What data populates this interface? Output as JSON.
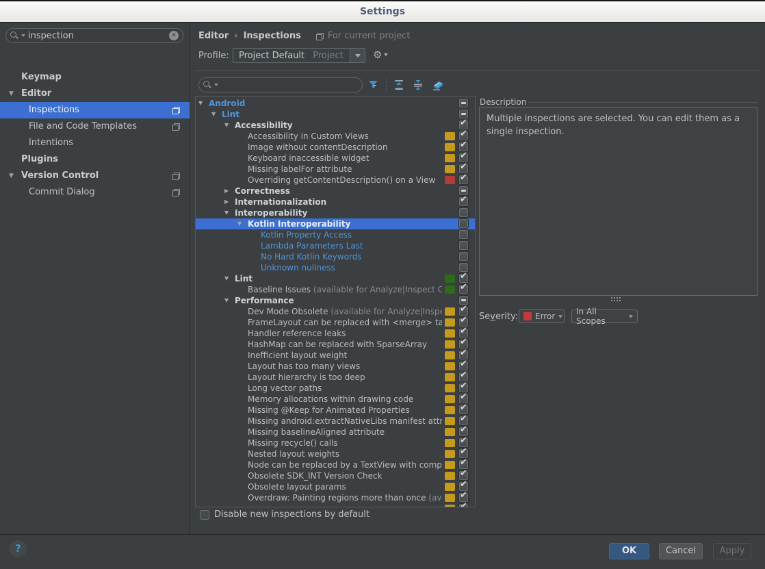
{
  "window": {
    "title": "Settings"
  },
  "colors": {
    "background": "#3c3f41",
    "selection_blue": "#3c6fd1",
    "changed_text_blue": "#5193d9",
    "severity_amber": "#c59a1d",
    "severity_red": "#b73a3a",
    "severity_green": "#2d6b1b",
    "toolbar_icon_blue": "#3d8fc6"
  },
  "sidebar": {
    "search": {
      "value": "inspection",
      "clear_icon": "close-circle-icon"
    },
    "items": [
      {
        "label": "Keymap",
        "level": 0,
        "bold": true
      },
      {
        "label": "Editor",
        "level": 0,
        "bold": true,
        "expanded": true
      },
      {
        "label": "Inspections",
        "level": 1,
        "selected": true,
        "copyIcon": true
      },
      {
        "label": "File and Code Templates",
        "level": 1,
        "copyIcon": true
      },
      {
        "label": "Intentions",
        "level": 1
      },
      {
        "label": "Plugins",
        "level": 0,
        "bold": true
      },
      {
        "label": "Version Control",
        "level": 0,
        "bold": true,
        "expanded": true,
        "copyIcon": true
      },
      {
        "label": "Commit Dialog",
        "level": 1,
        "copyIcon": true
      }
    ]
  },
  "header": {
    "breadcrumb": {
      "0": "Editor",
      "1": "Inspections",
      "separator": "›"
    },
    "scope_note": "For current project",
    "profile_label": "Profile:",
    "profile_value": "Project Default",
    "profile_suffix": "Project"
  },
  "toolbar": {
    "search_value": "",
    "icons": [
      "filter-icon",
      "expand-all-icon",
      "collapse-all-icon",
      "reset-filter-icon"
    ]
  },
  "inspection_tree": {
    "rows": [
      {
        "label": "Android",
        "level": 0,
        "arrow": "down",
        "style": "group-changed",
        "check": "dash"
      },
      {
        "label": "Lint",
        "level": 1,
        "arrow": "down",
        "style": "group-changed",
        "check": "dash"
      },
      {
        "label": "Accessibility",
        "level": 2,
        "arrow": "down",
        "style": "group",
        "check": "checked"
      },
      {
        "label": "Accessibility in Custom Views",
        "level": 3,
        "style": "item",
        "swatch": "amber",
        "check": "checked"
      },
      {
        "label": "Image without contentDescription",
        "level": 3,
        "style": "item",
        "swatch": "amber",
        "check": "checked"
      },
      {
        "label": "Keyboard inaccessible widget",
        "level": 3,
        "style": "item",
        "swatch": "amber",
        "check": "checked"
      },
      {
        "label": "Missing labelFor attribute",
        "level": 3,
        "style": "item",
        "swatch": "amber",
        "check": "checked"
      },
      {
        "label": "Overriding getContentDescription() on a View",
        "level": 3,
        "style": "item",
        "swatch": "red",
        "check": "checked"
      },
      {
        "label": "Correctness",
        "level": 2,
        "arrow": "right",
        "style": "group",
        "check": "dash"
      },
      {
        "label": "Internationalization",
        "level": 2,
        "arrow": "right",
        "style": "group",
        "check": "checked"
      },
      {
        "label": "Interoperability",
        "level": 2,
        "arrow": "down",
        "style": "group",
        "check": "unchecked"
      },
      {
        "label": "Kotlin Interoperability",
        "level": 3,
        "arrow": "down",
        "style": "group",
        "check": "unchecked",
        "selected": true
      },
      {
        "label": "Kotlin Property Access",
        "level": 4,
        "style": "item-changed",
        "check": "unchecked"
      },
      {
        "label": "Lambda Parameters Last",
        "level": 4,
        "style": "item-changed",
        "check": "unchecked"
      },
      {
        "label": "No Hard Kotlin Keywords",
        "level": 4,
        "style": "item-changed",
        "check": "unchecked"
      },
      {
        "label": "Unknown nullness",
        "level": 4,
        "style": "item-changed",
        "check": "unchecked"
      },
      {
        "label": "Lint",
        "level": 2,
        "arrow": "down",
        "style": "group",
        "swatch": "green",
        "check": "checked"
      },
      {
        "label": "Baseline Issues",
        "note": "(available for Analyze|Inspect Co",
        "level": 3,
        "style": "item",
        "swatch": "green",
        "check": "checked"
      },
      {
        "label": "Performance",
        "level": 2,
        "arrow": "down",
        "style": "group",
        "check": "dash"
      },
      {
        "label": "Dev Mode Obsolete",
        "note": "(available for Analyze|Inspec",
        "level": 3,
        "style": "item",
        "swatch": "amber",
        "check": "checked"
      },
      {
        "label": "FrameLayout can be replaced with <merge> ta",
        "level": 3,
        "style": "item",
        "swatch": "amber",
        "check": "checked"
      },
      {
        "label": "Handler reference leaks",
        "level": 3,
        "style": "item",
        "swatch": "amber",
        "check": "checked"
      },
      {
        "label": "HashMap can be replaced with SparseArray",
        "level": 3,
        "style": "item",
        "swatch": "amber",
        "check": "checked"
      },
      {
        "label": "Inefficient layout weight",
        "level": 3,
        "style": "item",
        "swatch": "amber",
        "check": "checked"
      },
      {
        "label": "Layout has too many views",
        "level": 3,
        "style": "item",
        "swatch": "amber",
        "check": "checked"
      },
      {
        "label": "Layout hierarchy is too deep",
        "level": 3,
        "style": "item",
        "swatch": "amber",
        "check": "checked"
      },
      {
        "label": "Long vector paths",
        "level": 3,
        "style": "item",
        "swatch": "amber",
        "check": "checked"
      },
      {
        "label": "Memory allocations within drawing code",
        "level": 3,
        "style": "item",
        "swatch": "amber",
        "check": "checked"
      },
      {
        "label": "Missing @Keep for Animated Properties",
        "level": 3,
        "style": "item",
        "swatch": "amber",
        "check": "checked"
      },
      {
        "label": "Missing android:extractNativeLibs manifest attr",
        "level": 3,
        "style": "item",
        "swatch": "amber",
        "check": "checked"
      },
      {
        "label": "Missing baselineAligned attribute",
        "level": 3,
        "style": "item",
        "swatch": "amber",
        "check": "checked"
      },
      {
        "label": "Missing recycle() calls",
        "level": 3,
        "style": "item",
        "swatch": "amber",
        "check": "checked"
      },
      {
        "label": "Nested layout weights",
        "level": 3,
        "style": "item",
        "swatch": "amber",
        "check": "checked"
      },
      {
        "label": "Node can be replaced by a TextView with comp",
        "level": 3,
        "style": "item",
        "swatch": "amber",
        "check": "checked"
      },
      {
        "label": "Obsolete SDK_INT Version Check",
        "level": 3,
        "style": "item",
        "swatch": "amber",
        "check": "checked"
      },
      {
        "label": "Obsolete layout params",
        "level": 3,
        "style": "item",
        "swatch": "amber",
        "check": "checked"
      },
      {
        "label": "Overdraw: Painting regions more than once",
        "note": "(av",
        "level": 3,
        "style": "item",
        "swatch": "amber",
        "check": "checked"
      },
      {
        "label": "",
        "level": 3,
        "style": "item",
        "swatch": "amber",
        "check": "checked"
      }
    ]
  },
  "description": {
    "title": "Description",
    "text": "Multiple inspections are selected. You can edit them as a single inspection."
  },
  "severity": {
    "label_pre": "Se",
    "label_mnemonic": "v",
    "label_post": "erity:",
    "value": "Error",
    "scope_value": "In All Scopes"
  },
  "options": {
    "disable_label": "Disable new inspections by default",
    "checked": false
  },
  "buttons": {
    "ok": "OK",
    "cancel": "Cancel",
    "apply": "Apply"
  }
}
